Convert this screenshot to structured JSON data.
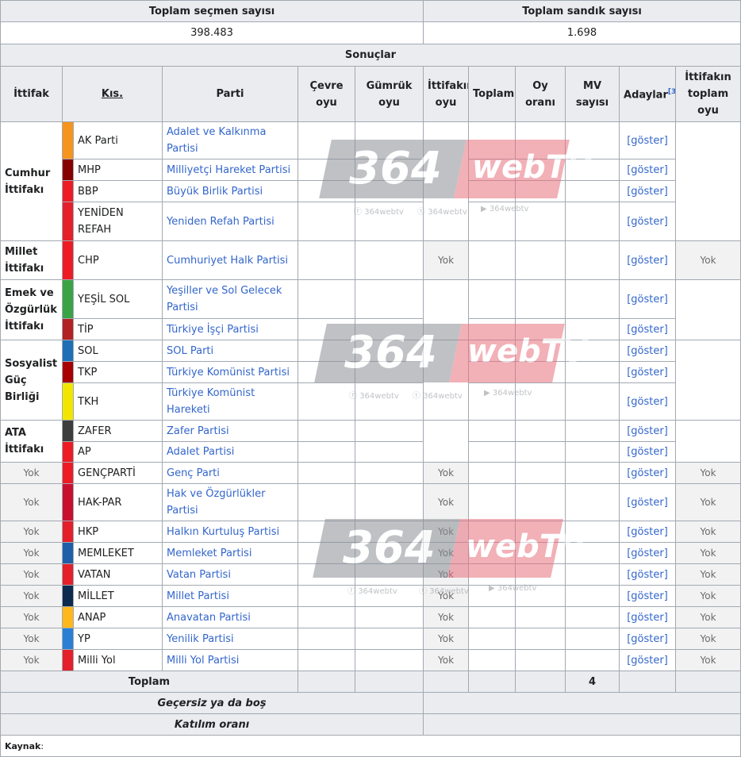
{
  "summary": {
    "voters_label": "Toplam seçmen sayısı",
    "boxes_label": "Toplam sandık sayısı",
    "voters_value": "398.483",
    "boxes_value": "1.698",
    "results_label": "Sonuçlar"
  },
  "headers": {
    "ittifak": "İttifak",
    "kis": "Kıs.",
    "parti": "Parti",
    "cevre1": "Çevre",
    "cevre2": "oyu",
    "gumruk1": "Gümrük",
    "gumruk2": "oyu",
    "ittifakin1": "İttifakın",
    "ittifakin2": "oyu",
    "toplam": "Toplam",
    "oy1": "Oy",
    "oy2": "oranı",
    "mv1": "MV",
    "mv2": "sayısı",
    "adaylar": "Adaylar",
    "adaylar_ref": "[3]",
    "itt_toplam1": "İttifakın",
    "itt_toplam2": "toplam",
    "itt_toplam3": "oyu"
  },
  "alliances": {
    "cumhur1": "Cumhur",
    "cumhur2": "İttifakı",
    "millet1": "Millet",
    "millet2": "İttifakı",
    "emek1": "Emek ve",
    "emek2": "Özgürlük",
    "emek3": "İttifakı",
    "sosyalist1": "Sosyalist",
    "sosyalist2": "Güç",
    "sosyalist3": "Birliği",
    "ata1": "ATA",
    "ata2": "İttifakı"
  },
  "parties": [
    {
      "abbr": "AK Parti",
      "name": "Adalet ve Kalkınma Partisi",
      "color": "#f7941d"
    },
    {
      "abbr": "MHP",
      "name": "Milliyetçi Hareket Partisi",
      "color": "#870000"
    },
    {
      "abbr": "BBP",
      "name": "Büyük Birlik Partisi",
      "color": "#ed1c24"
    },
    {
      "abbr1": "YENİDEN",
      "abbr2": "REFAH",
      "name": "Yeniden Refah Partisi",
      "color": "#e4202a"
    },
    {
      "abbr": "CHP",
      "name": "Cumhuriyet Halk Partisi",
      "color": "#ed1c24"
    },
    {
      "abbr": "YEŞİL SOL",
      "name1": "Yeşiller ve Sol Gelecek",
      "name2": "Partisi",
      "color": "#3aa346"
    },
    {
      "abbr": "TİP",
      "name": "Türkiye İşçi Partisi",
      "color": "#b22222"
    },
    {
      "abbr": "SOL",
      "name": "SOL Parti",
      "color": "#1f6fb5"
    },
    {
      "abbr": "TKP",
      "name": "Türkiye Komünist Partisi",
      "color": "#a80000"
    },
    {
      "abbr": "TKH",
      "name": "Türkiye Komünist Hareketi",
      "color": "#f2e600"
    },
    {
      "abbr": "ZAFER",
      "name": "Zafer Partisi",
      "color": "#3d3d3d"
    },
    {
      "abbr": "AP",
      "name": "Adalet Partisi",
      "color": "#ed1c24"
    },
    {
      "abbr": "GENÇPARTİ",
      "name": "Genç Parti",
      "color": "#ed1c24"
    },
    {
      "abbr": "HAK-PAR",
      "name": "Hak ve Özgürlükler Partisi",
      "color": "#c8102e"
    },
    {
      "abbr": "HKP",
      "name": "Halkın Kurtuluş Partisi",
      "color": "#e4202a"
    },
    {
      "abbr": "MEMLEKET",
      "name": "Memleket Partisi",
      "color": "#1f5fa8"
    },
    {
      "abbr": "VATAN",
      "name": "Vatan Partisi",
      "color": "#e4202a"
    },
    {
      "abbr": "MİLLET",
      "name": "Millet Partisi",
      "color": "#0d2a4f"
    },
    {
      "abbr": "ANAP",
      "name": "Anavatan Partisi",
      "color": "#ffb81c"
    },
    {
      "abbr": "YP",
      "name": "Yenilik Partisi",
      "color": "#2a7fd4"
    },
    {
      "abbr": "Milli Yol",
      "name": "Milli Yol Partisi",
      "color": "#e4202a"
    }
  ],
  "common": {
    "goster": "[göster]",
    "yok": "Yok"
  },
  "footer": {
    "toplam": "Toplam",
    "mv_total": "4",
    "gecersiz": "Geçersiz ya da boş",
    "katilim": "Katılım oranı",
    "kaynak": "Kaynak",
    "colon": ":"
  },
  "watermark": {
    "number": "364",
    "brand": "webTV",
    "fb": "364webtv",
    "tw": "364webtv",
    "yt": "364webtv"
  }
}
